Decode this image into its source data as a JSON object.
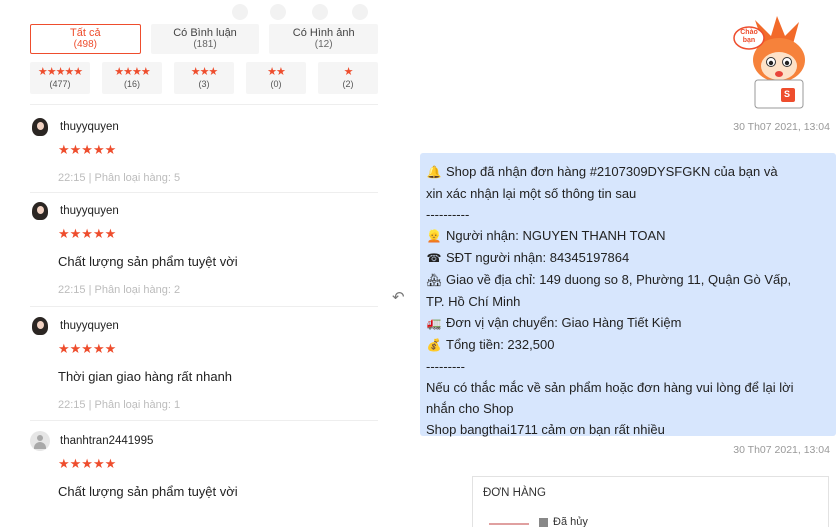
{
  "filters": {
    "tabs": [
      {
        "label": "Tất cả",
        "count": "(498)",
        "active": true
      },
      {
        "label": "Có Bình luận",
        "count": "(181)",
        "active": false
      },
      {
        "label": "Có Hình ảnh",
        "count": "(12)",
        "active": false
      }
    ],
    "stars": [
      {
        "stars": "★★★★★",
        "count": "(477)"
      },
      {
        "stars": "★★★★",
        "count": "(16)"
      },
      {
        "stars": "★★★",
        "count": "(3)"
      },
      {
        "stars": "★★",
        "count": "(0)"
      },
      {
        "stars": "★",
        "count": "(2)"
      }
    ]
  },
  "reviews": [
    {
      "user": "thuyyquyen",
      "rating": "★★★★★",
      "text": "",
      "meta": "22:15 |  Phân loại hàng: 5",
      "avatar": "girl"
    },
    {
      "user": "thuyyquyen",
      "rating": "★★★★★",
      "text": "Chất lượng sản phẩm tuyệt vời",
      "meta": "22:15 |  Phân loại hàng: 2",
      "avatar": "girl"
    },
    {
      "user": "thuyyquyen",
      "rating": "★★★★★",
      "text": "Thời gian giao hàng rất nhanh",
      "meta": "22:15 |  Phân loại hàng: 1",
      "avatar": "girl"
    },
    {
      "user": "thanhtran2441995",
      "rating": "★★★★★",
      "text": "Chất lượng sản phẩm tuyệt vời",
      "meta": "",
      "avatar": "default"
    }
  ],
  "chat": {
    "mascot_text": "Chào bạn",
    "mascot_badge": "S",
    "timestamp_1": "30 Th07 2021, 13:04",
    "timestamp_2": "30 Th07 2021, 13:04",
    "message_lines": [
      {
        "emoji": "🔔",
        "text": "Shop đã nhận đơn hàng #2107309DYSFGKN của bạn và"
      },
      {
        "emoji": "",
        "text": "xin xác nhận lại một số thông tin sau"
      },
      {
        "emoji": "",
        "text": "----------"
      },
      {
        "emoji": "👱",
        "text": "Người nhận: NGUYEN THANH TOAN"
      },
      {
        "emoji": "☎",
        "text": "SĐT người nhận: 84345197864"
      },
      {
        "emoji": "🏘",
        "text": "Giao về địa chỉ: 149 duong so 8, Phường 11, Quận Gò Vấp,"
      },
      {
        "emoji": "",
        "text": "TP. Hồ Chí Minh"
      },
      {
        "emoji": "🚛",
        "text": "Đơn vị vận chuyển: Giao Hàng Tiết Kiệm"
      },
      {
        "emoji": "💰",
        "text": "Tổng tiền: 232,500"
      },
      {
        "emoji": "",
        "text": "---------"
      },
      {
        "emoji": "",
        "text": "Nếu có thắc mắc về sản phẩm hoặc đơn hàng vui lòng để lại lời"
      },
      {
        "emoji": "",
        "text": "nhắn cho Shop"
      },
      {
        "emoji": "",
        "text": "Shop bangthai1711 cảm ơn bạn rất nhiều"
      }
    ],
    "order_card": {
      "title": "ĐƠN HÀNG",
      "status": "Đã hủy"
    }
  },
  "colors": {
    "accent": "#ee4d2d",
    "bubble": "#d7e6fd"
  }
}
